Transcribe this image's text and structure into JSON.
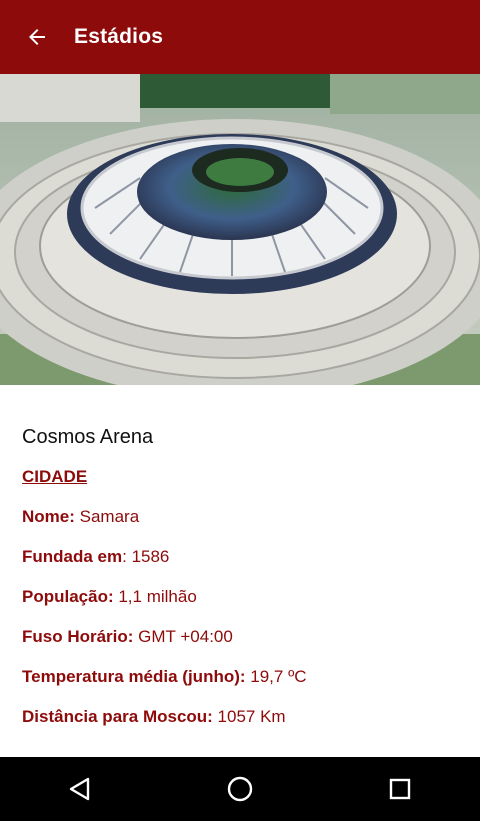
{
  "appbar": {
    "title": "Estádios",
    "back_icon": "arrow-left-icon",
    "color": "#8e0b0b"
  },
  "hero": {
    "image": "stadium-aerial-photo"
  },
  "stadium": {
    "name": "Cosmos Arena"
  },
  "city": {
    "section_title": "CIDADE",
    "rows": [
      {
        "label": "Nome:",
        "value": " Samara"
      },
      {
        "label": "Fundada em",
        "value": ": 1586"
      },
      {
        "label": "População:",
        "value": " 1,1 milhão"
      },
      {
        "label": "Fuso Horário:",
        "value": " GMT +04:00"
      },
      {
        "label": "Temperatura média (junho):",
        "value": " 19,7 ºC"
      },
      {
        "label": "Distância para Moscou:",
        "value": " 1057 Km"
      }
    ]
  },
  "navbar": {
    "icons": [
      "back-triangle-icon",
      "home-circle-icon",
      "recents-square-icon"
    ]
  }
}
